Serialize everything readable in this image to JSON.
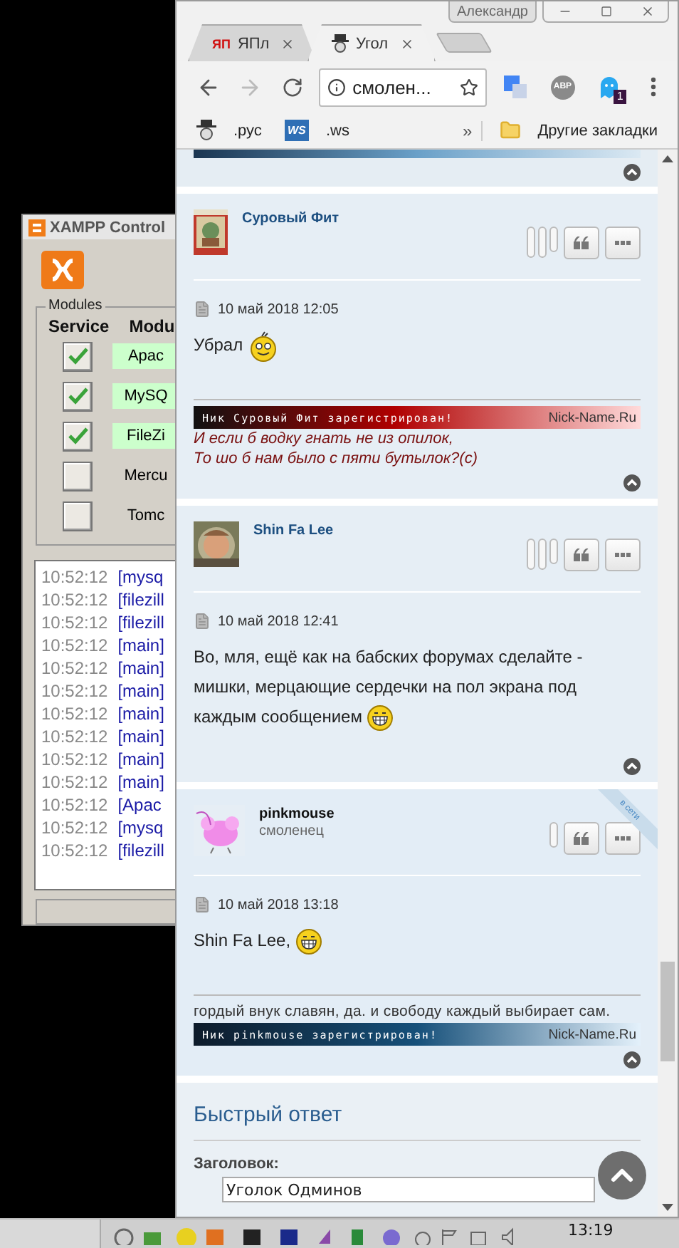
{
  "xampp": {
    "title": "XAMPP Control",
    "group": "Modules",
    "headers": [
      "Service",
      "Modu"
    ],
    "modules": [
      {
        "name": "Apac",
        "checked": true,
        "running": true
      },
      {
        "name": "MySQ",
        "checked": true,
        "running": true
      },
      {
        "name": "FileZi",
        "checked": true,
        "running": true
      },
      {
        "name": "Mercu",
        "checked": false,
        "running": false
      },
      {
        "name": "Tomc",
        "checked": false,
        "running": false
      }
    ],
    "log": [
      {
        "time": "10:52:12",
        "source": "[mysq"
      },
      {
        "time": "10:52:12",
        "source": "[filezill"
      },
      {
        "time": "10:52:12",
        "source": "[filezill"
      },
      {
        "time": "10:52:12",
        "source": "[main]"
      },
      {
        "time": "10:52:12",
        "source": "[main]"
      },
      {
        "time": "10:52:12",
        "source": "[main]"
      },
      {
        "time": "10:52:12",
        "source": "[main]"
      },
      {
        "time": "10:52:12",
        "source": "[main]"
      },
      {
        "time": "10:52:12",
        "source": "[main]"
      },
      {
        "time": "10:52:12",
        "source": "[main]"
      },
      {
        "time": "10:52:12",
        "source": "[Apac"
      },
      {
        "time": "10:52:12",
        "source": "[mysq"
      },
      {
        "time": "10:52:12",
        "source": "[filezill"
      }
    ]
  },
  "browser": {
    "profile": "Александр",
    "tabs": [
      {
        "title": "ЯПл",
        "favicon_text": "ЯП",
        "selected": false
      },
      {
        "title": "Угол",
        "selected": true
      }
    ],
    "address": "смолен...",
    "extensions": [
      {
        "kind": "translate"
      },
      {
        "kind": "abp",
        "text": "ABP"
      },
      {
        "kind": "ghost",
        "badge": "1"
      }
    ],
    "bookmarks": [
      {
        "label": ".рус",
        "kind": "hat"
      },
      {
        "label": ".ws",
        "kind": "logo",
        "icon_text": "WS"
      }
    ],
    "overflow": "»",
    "other_bookmarks": "Другие закладки"
  },
  "page": {
    "posts": [
      {
        "author": "Суровый Фит",
        "color": "#1d4f80",
        "pills": [
          {
            "kind": "tall"
          },
          {
            "kind": "tall"
          },
          {
            "kind": "short"
          }
        ],
        "date": "10 май 2018 12:05",
        "body": "Убрал",
        "emoticon": {
          "kind": "smile"
        },
        "signature": [
          {
            "kind": "banner",
            "text": "Ник Суровый Фит зарегистрирован!",
            "site": "Nick-Name.Ru",
            "color": "#b00000"
          },
          {
            "kind": "quote",
            "text": "И если б водку гнать не из опилок,"
          },
          {
            "kind": "quote",
            "text": "То шо б нам было с пяти бутылок?(с)"
          }
        ]
      },
      {
        "author": "Shin Fa Lee",
        "color": "#1d4f80",
        "pills": [
          {
            "kind": "tall"
          },
          {
            "kind": "tall"
          },
          {
            "kind": "short"
          }
        ],
        "date": "10 май 2018 12:41",
        "body": "Во, мля, ещё как на бабских форумах сделайте - мишки, мерцающие сердечки на пол экрана под каждым сообщением",
        "emoticon": {
          "kind": "grin"
        }
      },
      {
        "author": "pinkmouse",
        "color": "#111111",
        "rank": "смоленец",
        "online": true,
        "online_label": "в сети",
        "pills": [
          {
            "kind": "short"
          }
        ],
        "date": "10 май 2018 13:18",
        "body": "Shin Fa Lee,",
        "emoticon": {
          "kind": "grin"
        },
        "signature": [
          {
            "kind": "text",
            "text": "гордый внук славян, да. и свободу каждый выбирает сам."
          },
          {
            "kind": "banner",
            "text": "Ник pinkmouse зарегистрирован!",
            "site": "Nick-Name.Ru",
            "color": "#16507a"
          }
        ]
      }
    ],
    "quick_reply": {
      "title": "Быстрый ответ",
      "field_label": "Заголовок:",
      "field_value": "Уголок Одминов"
    }
  },
  "taskbar": {
    "clock": "13:19"
  }
}
